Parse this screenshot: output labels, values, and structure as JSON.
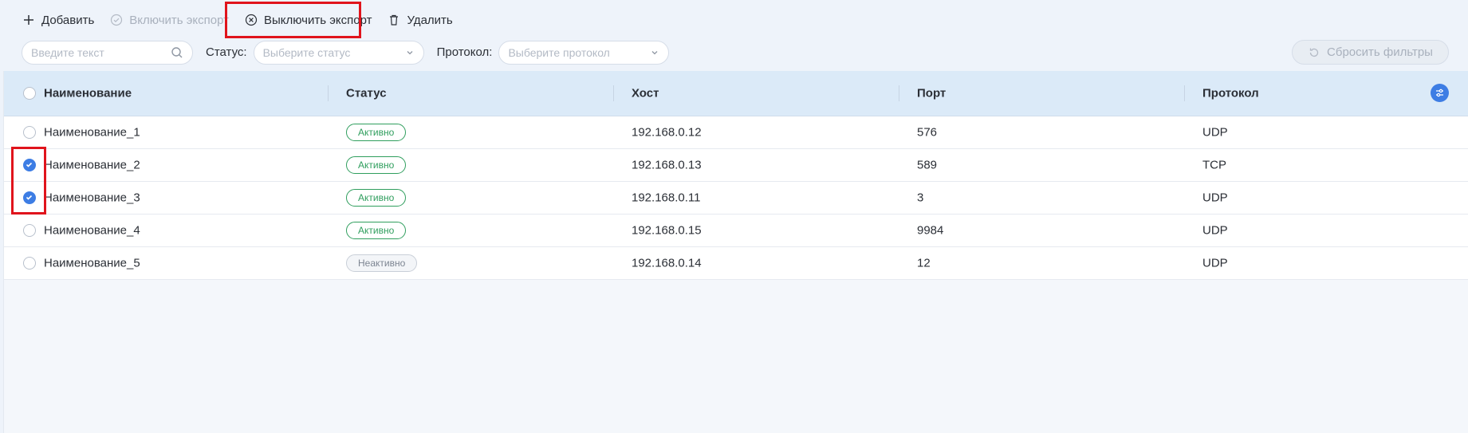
{
  "toolbar": {
    "add_label": "Добавить",
    "enable_export_label": "Включить экспорт",
    "disable_export_label": "Выключить экспорт",
    "delete_label": "Удалить"
  },
  "filters": {
    "search_placeholder": "Введите текст",
    "status_label": "Статус:",
    "status_placeholder": "Выберите статус",
    "protocol_label": "Протокол:",
    "protocol_placeholder": "Выберите протокол",
    "reset_label": "Сбросить фильтры"
  },
  "table": {
    "headers": [
      "Наименование",
      "Статус",
      "Хост",
      "Порт",
      "Протокол"
    ],
    "rows": [
      {
        "name": "Наименование_1",
        "status": "Активно",
        "host": "192.168.0.12",
        "port": "576",
        "protocol": "UDP",
        "checked": false
      },
      {
        "name": "Наименование_2",
        "status": "Активно",
        "host": "192.168.0.13",
        "port": "589",
        "protocol": "TCP",
        "checked": true
      },
      {
        "name": "Наименование_3",
        "status": "Активно",
        "host": "192.168.0.11",
        "port": "3",
        "protocol": "UDP",
        "checked": true
      },
      {
        "name": "Наименование_4",
        "status": "Активно",
        "host": "192.168.0.15",
        "port": "9984",
        "protocol": "UDP",
        "checked": false
      },
      {
        "name": "Наименование_5",
        "status": "Неактивно",
        "host": "192.168.0.14",
        "port": "12",
        "protocol": "UDP",
        "checked": false
      }
    ]
  },
  "colors": {
    "accent": "#3d7de4",
    "active_badge": "#2f9e5d",
    "highlight": "#e0141c"
  }
}
